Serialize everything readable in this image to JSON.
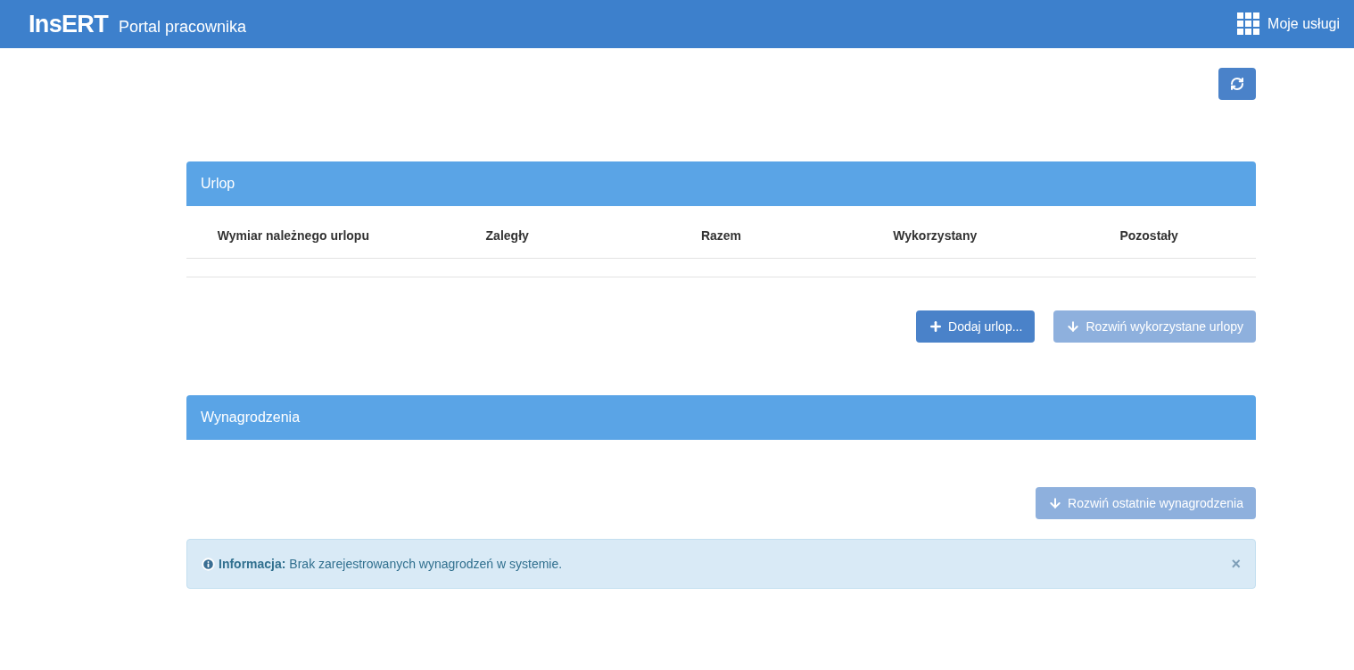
{
  "header": {
    "logo": "InsERT",
    "title": "Portal pracownika",
    "services_link": "Moje usługi"
  },
  "leave_panel": {
    "title": "Urlop",
    "columns": [
      "Wymiar należnego urlopu",
      "Zaległy",
      "Razem",
      "Wykorzystany",
      "Pozostały"
    ],
    "buttons": [
      {
        "kind": "add",
        "label": "Dodaj urlop...",
        "disabled": false
      },
      {
        "kind": "expand",
        "label": "Rozwiń wykorzystane urlopy",
        "disabled": true
      }
    ]
  },
  "salary_panel": {
    "title": "Wynagrodzenia",
    "buttons": [
      {
        "kind": "expand",
        "label": "Rozwiń ostatnie wynagrodzenia",
        "disabled": true
      }
    ],
    "alert": {
      "text": "**Informacja:** Brak zarejestrowanych wynagrodzeń w systemie.",
      "close": "×"
    }
  }
}
